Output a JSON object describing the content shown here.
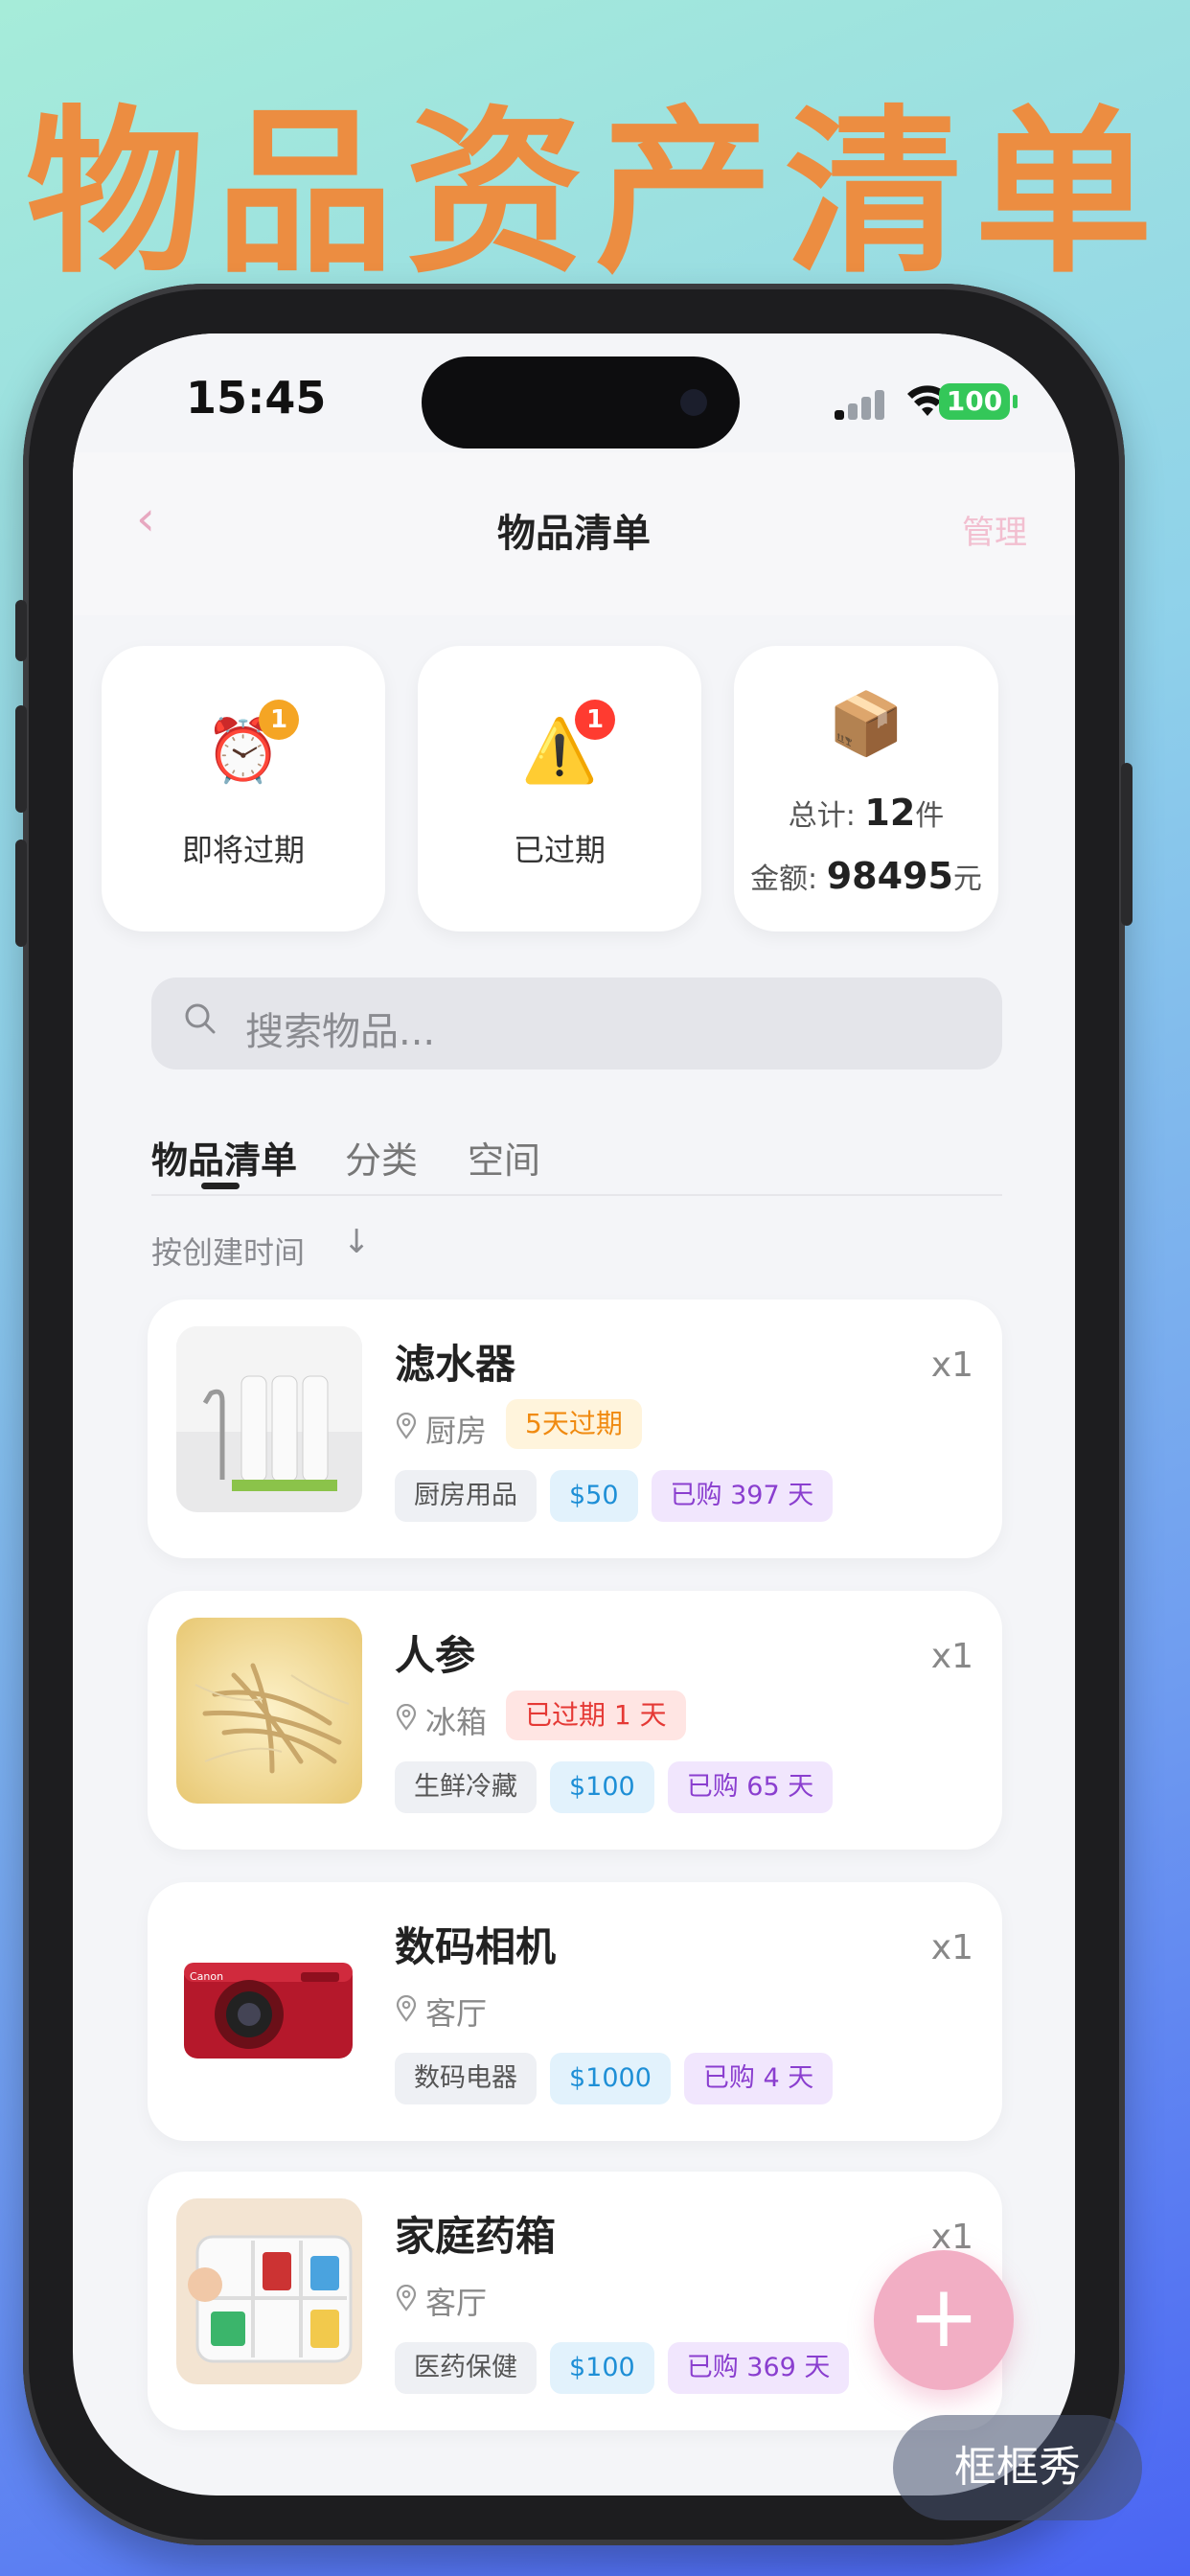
{
  "headline": "物品资产清单",
  "status_bar": {
    "time": "15:45",
    "battery": "100"
  },
  "nav": {
    "back_icon": "‹",
    "title": "物品清单",
    "manage": "管理"
  },
  "stats": {
    "expiring": {
      "label": "即将过期",
      "badge": "1",
      "icon": "alarm-clock-icon"
    },
    "expired": {
      "label": "已过期",
      "badge": "1",
      "icon": "warning-icon"
    },
    "total": {
      "icon": "package-icon",
      "count_label": "总计:",
      "count": "12",
      "count_unit": "件",
      "amount_label": "金额:",
      "amount": "98495",
      "amount_unit": "元"
    }
  },
  "search": {
    "placeholder": "搜索物品..."
  },
  "tabs": [
    {
      "label": "物品清单",
      "active": true
    },
    {
      "label": "分类",
      "active": false
    },
    {
      "label": "空间",
      "active": false
    }
  ],
  "sort": {
    "label": "按创建时间",
    "direction_icon": "arrow-down-icon"
  },
  "items": [
    {
      "name": "滤水器",
      "qty": "x1",
      "location": "厨房",
      "expiry": "5天过期",
      "category": "厨房用品",
      "price": "$50",
      "age": "已购 397 天"
    },
    {
      "name": "人参",
      "qty": "x1",
      "location": "冰箱",
      "expiry": "已过期 1 天",
      "category": "生鲜冷藏",
      "price": "$100",
      "age": "已购 65 天"
    },
    {
      "name": "数码相机",
      "qty": "x1",
      "location": "客厅",
      "category": "数码电器",
      "price": "$1000",
      "age": "已购 4 天"
    },
    {
      "name": "家庭药箱",
      "qty": "x1",
      "location": "客厅",
      "category": "医药保健",
      "price": "$100",
      "age": "已购 369 天"
    }
  ],
  "fab": {
    "label": "+"
  },
  "watermark": "框框秀",
  "colors": {
    "accent_pink": "#f2aec4",
    "headline_orange": "#ec8d41",
    "badge_orange": "#f5a524",
    "badge_red": "#ff3b30"
  }
}
